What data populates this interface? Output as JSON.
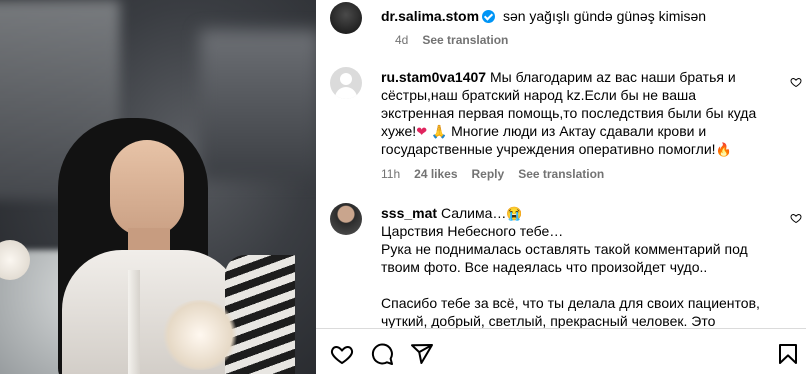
{
  "post": {
    "author": "dr.salima.stom",
    "caption": "sən yağışlı gündə günəş kimisən",
    "age": "4d",
    "see_translation": "See translation"
  },
  "comments": [
    {
      "username": "ru.stam0va1407",
      "text": "Мы благодарим аz вас наши братья и сёстры,наш братский народ kz.Если бы не ваша экстренная первая помощь,то последствия были бы куда хуже!",
      "text_tail": "Многие люди из Актау сдавали крови и государственные учреждения оперативно помогли!",
      "emoji_1": "❤",
      "emoji_2": "🙏",
      "emoji_3": "🔥",
      "age": "11h",
      "likes": "24 likes",
      "reply": "Reply",
      "see_translation": "See translation"
    },
    {
      "username": "sss_mat",
      "line1": "Салима…",
      "emoji": "😭",
      "line2": "Царствия Небесного тебе…",
      "para1": "Рука не поднималась оставлять такой комментарий под твоим фото. Все надеялась что произойдет чудо..",
      "para2": "Спасибо тебе за всё, что ты делала для своих пациентов, чуткий, добрый, светлый, прекрасный человек. Это первое"
    }
  ],
  "actions": {
    "like": "heart-icon",
    "comment": "comment-icon",
    "share": "share-icon",
    "save": "bookmark-icon"
  }
}
